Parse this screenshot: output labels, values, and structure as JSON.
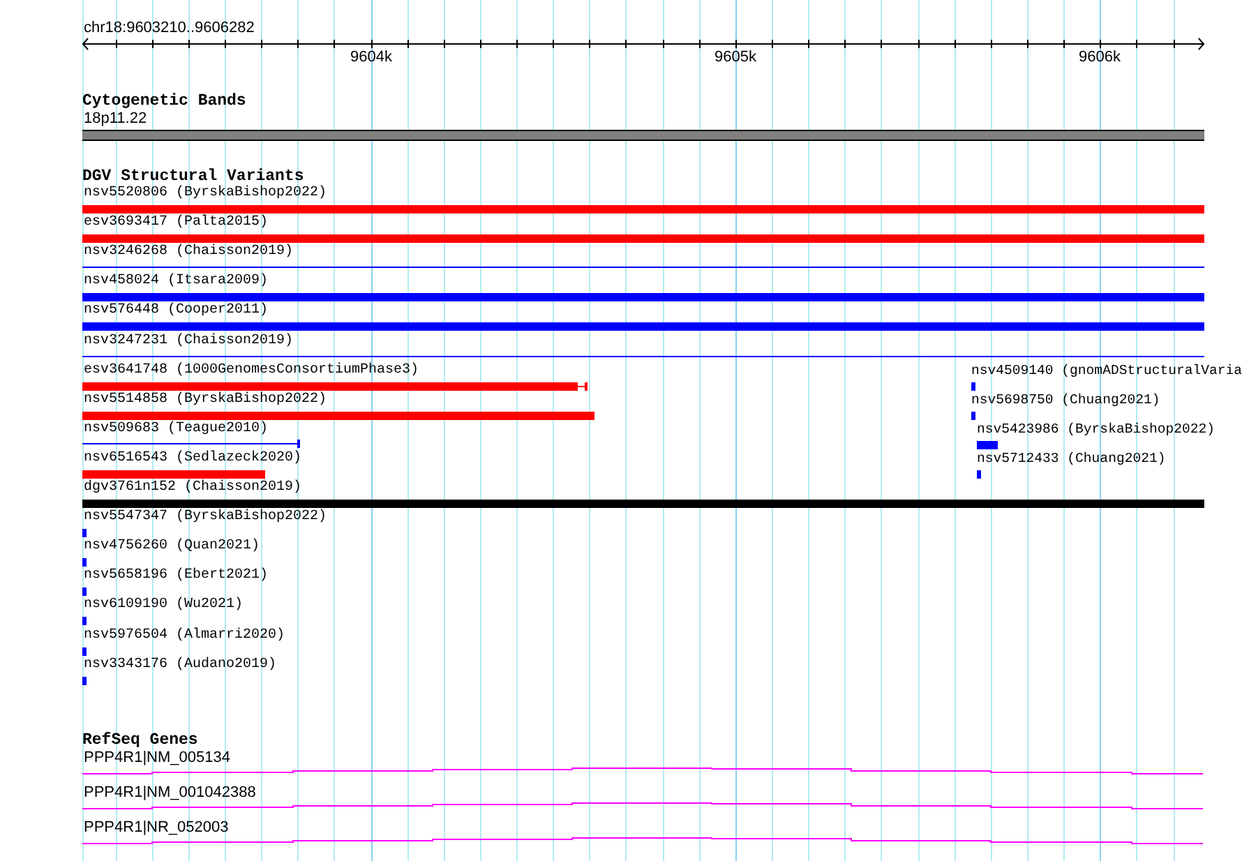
{
  "ruler": {
    "location": "chr18:9603210..9606282",
    "tick_labels": [
      "9604k",
      "9605k",
      "9606k"
    ]
  },
  "tracks": [
    {
      "kind": "cytoband",
      "title": "Cytogenetic Bands",
      "features": [
        {
          "label": "18p11.22"
        }
      ]
    },
    {
      "kind": "variants",
      "title": "DGV Structural Variants",
      "features": [
        {
          "label": "nsv5520806 (ByrskaBishop2022)",
          "color": "#ff0000"
        },
        {
          "label": "esv3693417 (Palta2015)",
          "color": "#ff0000"
        },
        {
          "label": "nsv3246268 (Chaisson2019)",
          "color": "#0000ff"
        },
        {
          "label": "nsv458024 (Itsara2009)",
          "color": "#0000ff"
        },
        {
          "label": "nsv576448 (Cooper2011)",
          "color": "#0000ff"
        },
        {
          "label": "nsv3247231 (Chaisson2019)",
          "color": "#0000ff"
        },
        {
          "label": "esv3641748 (1000GenomesConsortiumPhase3)",
          "color": "#ff0000"
        },
        {
          "label": "nsv4509140 (gnomADStructuralVaria",
          "color": "#0000ff"
        },
        {
          "label": "nsv5514858 (ByrskaBishop2022)",
          "color": "#ff0000"
        },
        {
          "label": "nsv5698750 (Chuang2021)",
          "color": "#0000ff"
        },
        {
          "label": "nsv509683 (Teague2010)",
          "color": "#0000ff"
        },
        {
          "label": "nsv5423986 (ByrskaBishop2022)",
          "color": "#0000ff"
        },
        {
          "label": "nsv6516543 (Sedlazeck2020)",
          "color": "#ff0000"
        },
        {
          "label": "nsv5712433 (Chuang2021)",
          "color": "#0000ff"
        },
        {
          "label": "dgv3761n152 (Chaisson2019)",
          "color": "#000000"
        },
        {
          "label": "nsv5547347 (ByrskaBishop2022)",
          "color": "#0000ff"
        },
        {
          "label": "nsv4756260 (Quan2021)",
          "color": "#0000ff"
        },
        {
          "label": "nsv5658196 (Ebert2021)",
          "color": "#0000ff"
        },
        {
          "label": "nsv6109190 (Wu2021)",
          "color": "#0000ff"
        },
        {
          "label": "nsv5976504 (Almarri2020)",
          "color": "#0000ff"
        },
        {
          "label": "nsv3343176 (Audano2019)",
          "color": "#0000ff"
        }
      ]
    },
    {
      "kind": "genes",
      "title": "RefSeq Genes",
      "features": [
        {
          "label": "PPP4R1|NM_005134"
        },
        {
          "label": "PPP4R1|NM_001042388"
        },
        {
          "label": "PPP4R1|NR_052003"
        }
      ]
    }
  ]
}
